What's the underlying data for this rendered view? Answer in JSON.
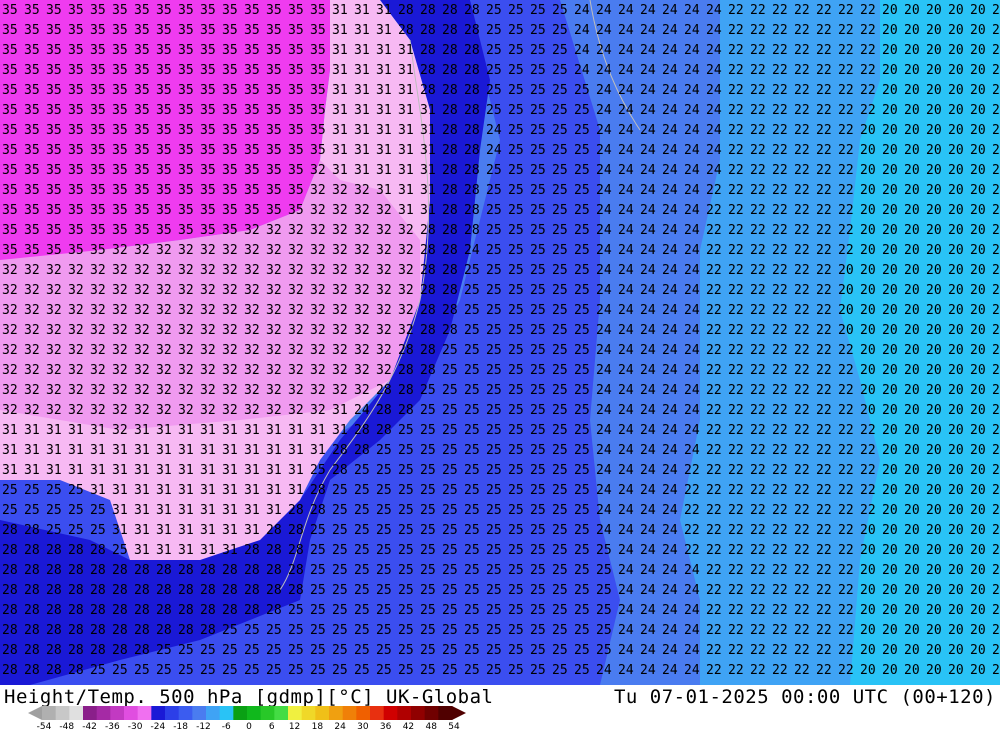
{
  "title": {
    "left": "Height/Temp. 500 hPa [gdmp][°C] UK-Global",
    "right": "Tu 07-01-2025 00:00 UTC (00+120)"
  },
  "colors": {
    "magenta": "#ef3bf0",
    "pink": "#f09af0",
    "lightpink": "#f7b9f3",
    "darkblue": "#1a19d6",
    "blue": "#3b4ef0",
    "midblue": "#4a7cf0",
    "lightblue": "#3fa3f5",
    "cyan": "#29c3f6"
  },
  "colorbar": {
    "colors": [
      "#b0b0b0",
      "#c8c8c8",
      "#e0e0e0",
      "#8a1f8a",
      "#a52aa5",
      "#c23ac2",
      "#e04ee0",
      "#f070f0",
      "#1a19d6",
      "#2c3fe8",
      "#3b5cf0",
      "#4a7cf0",
      "#3fa3f5",
      "#29c3f6",
      "#0aa014",
      "#10b81c",
      "#28c828",
      "#44dc44",
      "#f0f040",
      "#f0d828",
      "#f0c018",
      "#f0a010",
      "#f08008",
      "#f06000",
      "#e83010",
      "#d00000",
      "#b00000",
      "#900000",
      "#700000",
      "#500000"
    ],
    "labels": [
      "-54",
      "-48",
      "-42",
      "-36",
      "-30",
      "-24",
      "-18",
      "-12",
      "-6",
      "0",
      "6",
      "12",
      "18",
      "24",
      "30",
      "36",
      "42",
      "48",
      "54"
    ]
  },
  "map_labels": {
    "magenta": "35",
    "pink": "32",
    "lightpink": "31",
    "darkblue": "28",
    "blue": "25",
    "midblue": "24",
    "lightblue": "22",
    "cyan": "20"
  }
}
